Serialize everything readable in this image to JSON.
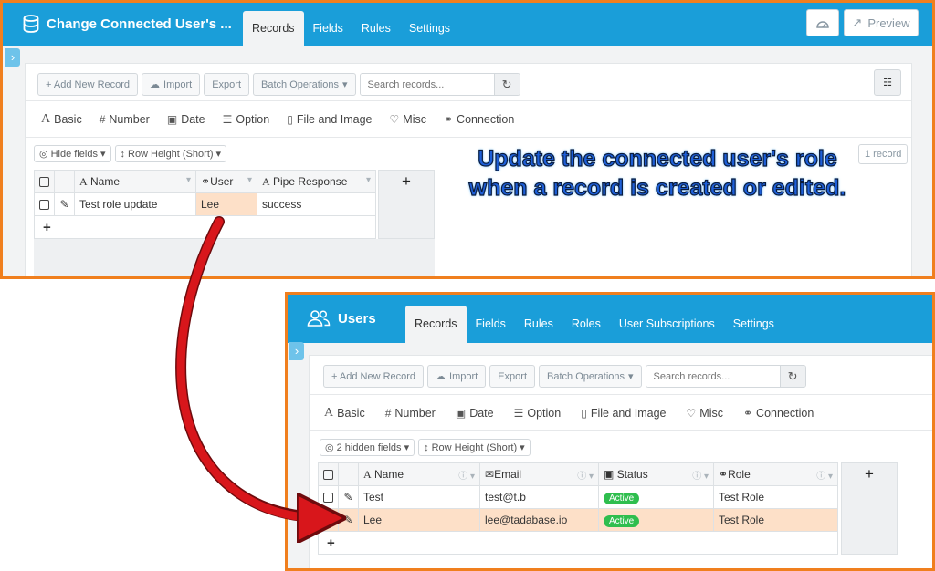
{
  "top_panel": {
    "title": "Change Connected User's ...",
    "tabs": [
      "Records",
      "Fields",
      "Rules",
      "Settings"
    ],
    "active_tab": "Records",
    "preview_label": "Preview",
    "toolbar": {
      "add_label": "+ Add New Record",
      "import_label": "Import",
      "export_label": "Export",
      "batch_label": "Batch Operations",
      "search_placeholder": "Search records..."
    },
    "field_types": [
      "Basic",
      "Number",
      "Date",
      "Option",
      "File and Image",
      "Misc",
      "Connection"
    ],
    "hide_fields_label": "Hide fields",
    "row_height_label": "Row Height (Short)",
    "record_count": "1 record",
    "columns": [
      "Name",
      "User",
      "Pipe Response"
    ],
    "rows": [
      {
        "name": "Test role update",
        "user": "Lee",
        "pipe_response": "success"
      }
    ]
  },
  "bottom_panel": {
    "title": "Users",
    "tabs": [
      "Records",
      "Fields",
      "Rules",
      "Roles",
      "User Subscriptions",
      "Settings"
    ],
    "active_tab": "Records",
    "toolbar": {
      "add_label": "+ Add New Record",
      "import_label": "Import",
      "export_label": "Export",
      "batch_label": "Batch Operations",
      "search_placeholder": "Search records..."
    },
    "field_types": [
      "Basic",
      "Number",
      "Date",
      "Option",
      "File and Image",
      "Misc",
      "Connection"
    ],
    "hidden_fields_label": "2 hidden fields",
    "row_height_label": "Row Height (Short)",
    "columns": [
      "Name",
      "Email",
      "Status",
      "Role"
    ],
    "rows": [
      {
        "name": "Test",
        "email": "test@t.b",
        "status": "Active",
        "role": "Test Role"
      },
      {
        "name": "Lee",
        "email": "lee@tadabase.io",
        "status": "Active",
        "role": "Test Role"
      }
    ]
  },
  "annotation": {
    "line1": "Update the connected user's role",
    "line2": "when a record is created or edited."
  },
  "colors": {
    "header_blue": "#1a9ed9",
    "panel_border": "#f07f1e",
    "highlight": "#fde0c8",
    "status_green": "#2fbe4e",
    "arrow_red": "#d8161b"
  },
  "icons": {
    "database": "database-icon",
    "users": "users-icon",
    "arrow": "curved-arrow"
  }
}
